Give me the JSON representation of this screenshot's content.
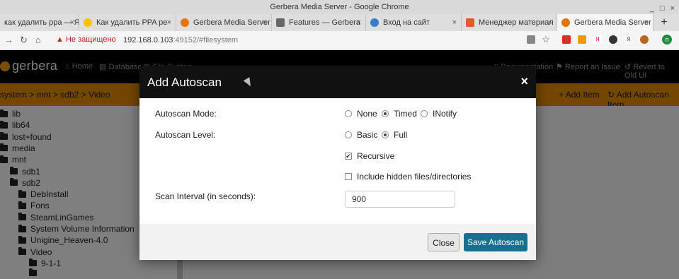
{
  "window": {
    "title": "Gerbera Media Server - Google Chrome",
    "controls": [
      "_",
      "□",
      "×"
    ]
  },
  "tabs": [
    {
      "label": "как удалить ppa — Я",
      "icon_color": "#ffffff"
    },
    {
      "label": "Как удалить PPA ре",
      "icon_color": "#f7c400"
    },
    {
      "label": "Gerbera Media Server",
      "icon_color": "#e8720c"
    },
    {
      "label": "Features — Gerbera",
      "icon_color": "#555555"
    },
    {
      "label": "Вход на сайт",
      "icon_color": "#3b7dc4"
    },
    {
      "label": "Менеджер материал",
      "icon_color": "#e05a2b"
    },
    {
      "label": "Gerbera Media Server",
      "icon_color": "#e8720c",
      "active": true
    }
  ],
  "new_tab_label": "+",
  "address": {
    "security": "Не защищено",
    "host": "192.168.0.103",
    "rest": ":49152/#filesystem"
  },
  "app": {
    "logo": "gerbera",
    "nav": {
      "home": "Home",
      "database": "Database",
      "filesystem": "File System",
      "documentation": "Documentation",
      "report_issue": "Report an Issue",
      "revert": "Revert to Old UI"
    }
  },
  "breadcrumb": {
    "path": "system > mnt > sdb2 > Video",
    "add_item": "Add Item",
    "add_autoscan": "Add Autoscan Item"
  },
  "tree": [
    {
      "label": "lib",
      "indent": 0
    },
    {
      "label": "lib64",
      "indent": 0
    },
    {
      "label": "lost+found",
      "indent": 0
    },
    {
      "label": "media",
      "indent": 0
    },
    {
      "label": "mnt",
      "indent": 0
    },
    {
      "label": "sdb1",
      "indent": 1
    },
    {
      "label": "sdb2",
      "indent": 1
    },
    {
      "label": "DebInstall",
      "indent": 2
    },
    {
      "label": "Fons",
      "indent": 2
    },
    {
      "label": "SteamLinGames",
      "indent": 2
    },
    {
      "label": "System Volume Information",
      "indent": 2
    },
    {
      "label": "Unigine_Heaven-4.0",
      "indent": 2
    },
    {
      "label": "Video",
      "indent": 2
    },
    {
      "label": "9-1-1",
      "indent": 3
    },
    {
      "label": "",
      "indent": 3
    }
  ],
  "modal": {
    "title": "Add Autoscan",
    "close_symbol": "×",
    "mode": {
      "label": "Autoscan Mode:",
      "options": [
        "None",
        "Timed",
        "INotify"
      ],
      "selected": "Timed"
    },
    "level": {
      "label": "Autoscan Level:",
      "options": [
        "Basic",
        "Full"
      ],
      "selected": "Full"
    },
    "recursive": {
      "label": "Recursive",
      "checked": true
    },
    "hidden": {
      "label": "Include hidden files/directories",
      "checked": false
    },
    "interval": {
      "label": "Scan Interval (in seconds):",
      "value": "900"
    },
    "close_button": "Close",
    "save_button": "Save Autoscan"
  }
}
